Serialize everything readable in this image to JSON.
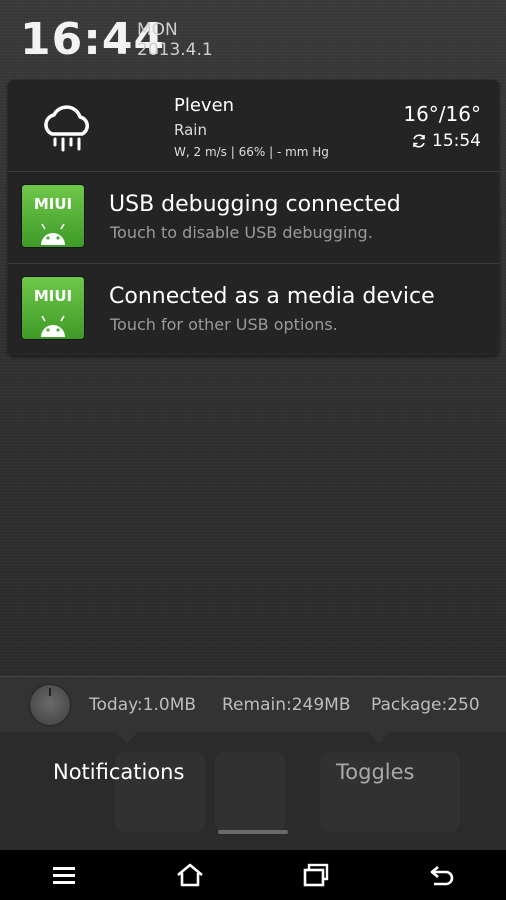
{
  "status": {
    "time": "16:44",
    "day": "MON",
    "date": "2013.4.1"
  },
  "weather": {
    "icon": "rain-cloud-icon",
    "city": "Pleven",
    "condition": "Rain",
    "details": "W, 2 m/s | 66% | - mm Hg",
    "temperature": "16°/16°",
    "updated_time": "15:54"
  },
  "notifications": [
    {
      "app_icon_text": "MIUI",
      "title": "USB debugging connected",
      "subtitle": "Touch to disable USB debugging."
    },
    {
      "app_icon_text": "MIUI",
      "title": "Connected as a media device",
      "subtitle": "Touch for other USB options."
    }
  ],
  "traffic": {
    "today": "Today:1.0MB",
    "remain": "Remain:249MB",
    "package": "Package:250"
  },
  "tabs": {
    "notifications": "Notifications",
    "toggles": "Toggles"
  },
  "colors": {
    "app_icon_green": "#4fae32",
    "panel_bg": "#242424",
    "shade_bg": "#333333"
  }
}
